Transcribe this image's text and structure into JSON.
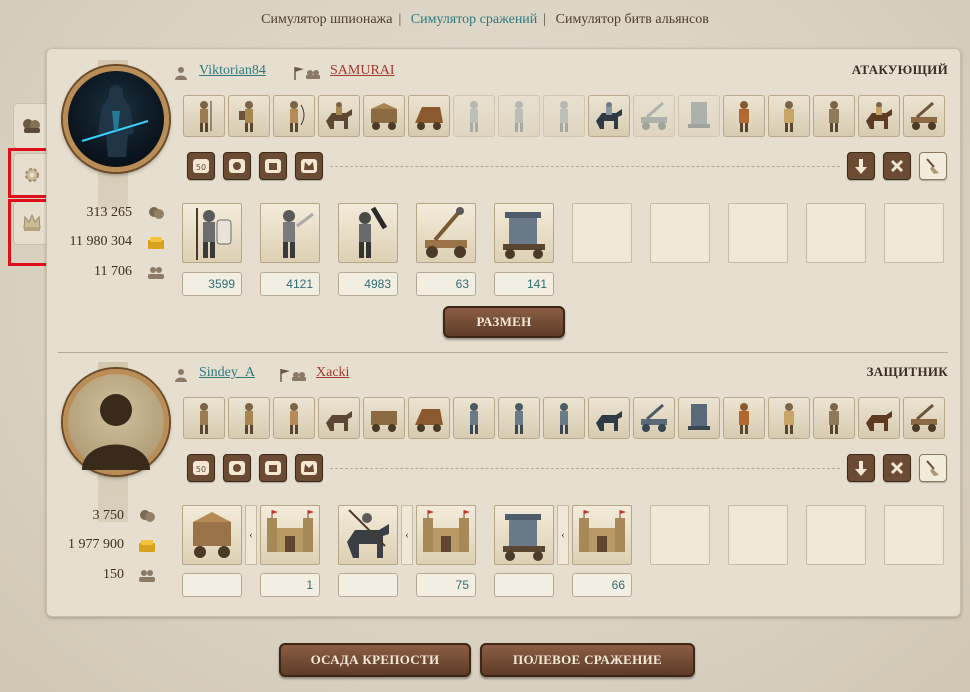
{
  "nav": {
    "items": [
      "Симулятор шпионажа",
      "Симулятор сражений",
      "Симулятор битв альянсов"
    ],
    "separator": "|",
    "active_index": 1
  },
  "attacker": {
    "username": "Viktorian84",
    "alliance": "SAMURAI",
    "role": "АТАКУЮЩИЙ",
    "stats": {
      "power": "313 265",
      "gold": "11 980 304",
      "population": "11 706"
    },
    "units": [
      {
        "name": "spearman-1",
        "count": "3599"
      },
      {
        "name": "swordsman",
        "count": "4121"
      },
      {
        "name": "knight-heavy",
        "count": "4983"
      },
      {
        "name": "catapult",
        "count": "63"
      },
      {
        "name": "siege-tower",
        "count": "141"
      }
    ],
    "exchange_button": "РАЗМЕН"
  },
  "defender": {
    "username": "Sindey_A",
    "alliance": "Xacki",
    "role": "ЗАЩИТНИК",
    "stats": {
      "power": "3 750",
      "gold": "1 977 900",
      "population": "150"
    },
    "pairs": [
      {
        "unit": "ram-cart",
        "target_count": "1"
      },
      {
        "unit": "cavalry-spear",
        "target_count": "75"
      },
      {
        "unit": "siege-tower",
        "target_count": "66"
      }
    ]
  },
  "buttons": {
    "siege": "ОСАДА КРЕПОСТИ",
    "field": "ПОЛЕВОЕ СРАЖЕНИЕ"
  },
  "colors": {
    "link": "#2f7a80",
    "alliance": "#a03a2a",
    "button": "#6e4a33",
    "highlight": "#e0101a"
  }
}
